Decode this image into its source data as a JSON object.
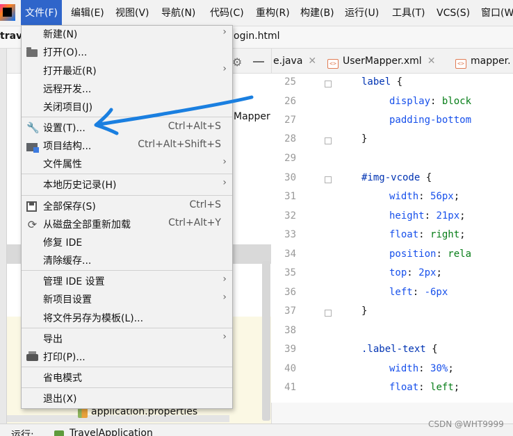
{
  "menubar": {
    "items": [
      "文件(F)",
      "编辑(E)",
      "视图(V)",
      "导航(N)",
      "代码(C)",
      "重构(R)",
      "构建(B)",
      "运行(U)",
      "工具(T)",
      "VCS(S)",
      "窗口(W"
    ]
  },
  "navbar": {
    "project": "trave",
    "file": "ogin.html"
  },
  "project_pane": {
    "tree_item": "Mapper",
    "props_file": "application.properties"
  },
  "editor_tabs": [
    {
      "label": "e.java"
    },
    {
      "label": "UserMapper.xml"
    },
    {
      "label": "mapper."
    }
  ],
  "editor": {
    "lines": [
      {
        "no": "25",
        "indent": 2,
        "tokens": [
          {
            "t": "label",
            "c": "c-sel"
          },
          {
            "t": " {",
            "c": "c-punct"
          }
        ]
      },
      {
        "no": "26",
        "indent": 3,
        "tokens": [
          {
            "t": "display",
            "c": "c-prop"
          },
          {
            "t": ": ",
            "c": "c-punct"
          },
          {
            "t": "block",
            "c": "c-val"
          }
        ]
      },
      {
        "no": "27",
        "indent": 3,
        "tokens": [
          {
            "t": "padding-bottom",
            "c": "c-prop"
          }
        ]
      },
      {
        "no": "28",
        "indent": 2,
        "tokens": [
          {
            "t": "}",
            "c": "c-punct"
          }
        ]
      },
      {
        "no": "29",
        "indent": 0,
        "tokens": []
      },
      {
        "no": "30",
        "indent": 2,
        "tokens": [
          {
            "t": "#img-vcode",
            "c": "c-sel"
          },
          {
            "t": " {",
            "c": "c-punct"
          }
        ]
      },
      {
        "no": "31",
        "indent": 3,
        "tokens": [
          {
            "t": "width",
            "c": "c-prop"
          },
          {
            "t": ": ",
            "c": "c-punct"
          },
          {
            "t": "56px",
            "c": "c-num"
          },
          {
            "t": ";",
            "c": "c-punct"
          }
        ]
      },
      {
        "no": "32",
        "indent": 3,
        "tokens": [
          {
            "t": "height",
            "c": "c-prop"
          },
          {
            "t": ": ",
            "c": "c-punct"
          },
          {
            "t": "21px",
            "c": "c-num"
          },
          {
            "t": ";",
            "c": "c-punct"
          }
        ]
      },
      {
        "no": "33",
        "indent": 3,
        "tokens": [
          {
            "t": "float",
            "c": "c-prop"
          },
          {
            "t": ": ",
            "c": "c-punct"
          },
          {
            "t": "right",
            "c": "c-val"
          },
          {
            "t": ";",
            "c": "c-punct"
          }
        ]
      },
      {
        "no": "34",
        "indent": 3,
        "tokens": [
          {
            "t": "position",
            "c": "c-prop"
          },
          {
            "t": ": ",
            "c": "c-punct"
          },
          {
            "t": "rela",
            "c": "c-val"
          }
        ]
      },
      {
        "no": "35",
        "indent": 3,
        "tokens": [
          {
            "t": "top",
            "c": "c-prop"
          },
          {
            "t": ": ",
            "c": "c-punct"
          },
          {
            "t": "2px",
            "c": "c-num"
          },
          {
            "t": ";",
            "c": "c-punct"
          }
        ]
      },
      {
        "no": "36",
        "indent": 3,
        "tokens": [
          {
            "t": "left",
            "c": "c-prop"
          },
          {
            "t": ": ",
            "c": "c-punct"
          },
          {
            "t": "-6px",
            "c": "c-num"
          }
        ]
      },
      {
        "no": "37",
        "indent": 2,
        "tokens": [
          {
            "t": "}",
            "c": "c-punct"
          }
        ]
      },
      {
        "no": "38",
        "indent": 0,
        "tokens": []
      },
      {
        "no": "39",
        "indent": 2,
        "tokens": [
          {
            "t": ".label-text",
            "c": "c-sel"
          },
          {
            "t": " {",
            "c": "c-punct"
          }
        ]
      },
      {
        "no": "40",
        "indent": 3,
        "tokens": [
          {
            "t": "width",
            "c": "c-prop"
          },
          {
            "t": ": ",
            "c": "c-punct"
          },
          {
            "t": "30%",
            "c": "c-num"
          },
          {
            "t": ";",
            "c": "c-punct"
          }
        ]
      },
      {
        "no": "41",
        "indent": 3,
        "tokens": [
          {
            "t": "float",
            "c": "c-prop"
          },
          {
            "t": ": ",
            "c": "c-punct"
          },
          {
            "t": "left",
            "c": "c-val"
          },
          {
            "t": ";",
            "c": "c-punct"
          }
        ]
      }
    ]
  },
  "file_menu": {
    "items": [
      {
        "label": "新建(N)",
        "shortcut": "",
        "submenu": true,
        "icon": ""
      },
      {
        "label": "打开(O)...",
        "shortcut": "",
        "submenu": false,
        "icon": "folder-icon"
      },
      {
        "label": "打开最近(R)",
        "shortcut": "",
        "submenu": true,
        "icon": ""
      },
      {
        "label": "远程开发...",
        "shortcut": "",
        "submenu": false,
        "icon": ""
      },
      {
        "label": "关闭项目(J)",
        "shortcut": "",
        "submenu": false,
        "icon": ""
      },
      {
        "label": "设置(T)...",
        "shortcut": "Ctrl+Alt+S",
        "submenu": false,
        "icon": "wrench-icon"
      },
      {
        "label": "项目结构...",
        "shortcut": "Ctrl+Alt+Shift+S",
        "submenu": false,
        "icon": "structure-icon"
      },
      {
        "label": "文件属性",
        "shortcut": "",
        "submenu": true,
        "icon": ""
      },
      {
        "label": "本地历史记录(H)",
        "shortcut": "",
        "submenu": true,
        "icon": ""
      },
      {
        "label": "全部保存(S)",
        "shortcut": "Ctrl+S",
        "submenu": false,
        "icon": "save-icon"
      },
      {
        "label": "从磁盘全部重新加载",
        "shortcut": "Ctrl+Alt+Y",
        "submenu": false,
        "icon": "reload-icon"
      },
      {
        "label": "修复 IDE",
        "shortcut": "",
        "submenu": false,
        "icon": ""
      },
      {
        "label": "清除缓存...",
        "shortcut": "",
        "submenu": false,
        "icon": ""
      },
      {
        "label": "管理 IDE 设置",
        "shortcut": "",
        "submenu": true,
        "icon": ""
      },
      {
        "label": "新项目设置",
        "shortcut": "",
        "submenu": true,
        "icon": ""
      },
      {
        "label": "将文件另存为模板(L)...",
        "shortcut": "",
        "submenu": false,
        "icon": ""
      },
      {
        "label": "导出",
        "shortcut": "",
        "submenu": true,
        "icon": ""
      },
      {
        "label": "打印(P)...",
        "shortcut": "",
        "submenu": false,
        "icon": "print-icon"
      },
      {
        "label": "省电模式",
        "shortcut": "",
        "submenu": false,
        "icon": ""
      },
      {
        "label": "退出(X)",
        "shortcut": "",
        "submenu": false,
        "icon": ""
      }
    ]
  },
  "run_bar": {
    "label": "运行:",
    "config": "TravelApplication"
  },
  "watermark": "CSDN @WHT9999",
  "colors": {
    "menu_active": "#2f65ca",
    "annotation": "#1a7fe0"
  }
}
